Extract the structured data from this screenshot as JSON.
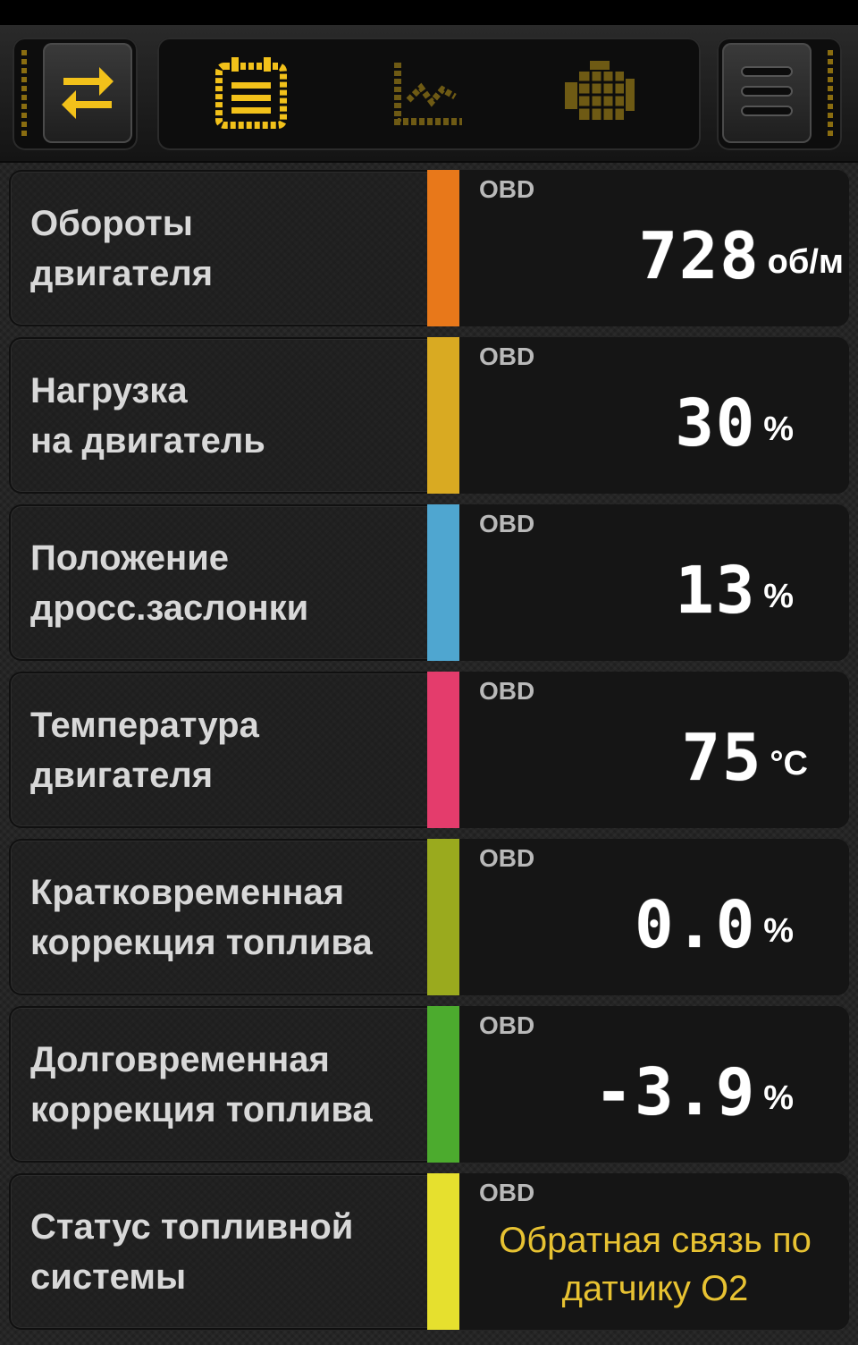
{
  "toolbar": {
    "left_button_icon": "swap-arrows-icon",
    "tabs": [
      {
        "icon": "dashboard-grid-icon",
        "active": true
      },
      {
        "icon": "chart-icon",
        "active": false
      },
      {
        "icon": "engine-icon",
        "active": false
      }
    ],
    "right_button_icon": "menu-icon"
  },
  "colors": {
    "accent": "#f2c11a",
    "inactive_icon": "#6e5a14"
  },
  "rows": [
    {
      "label": "Обороты\nдвигателя",
      "source": "OBD",
      "value": "728",
      "unit": "об/м",
      "bar_color": "#e8781a"
    },
    {
      "label": "Нагрузка\nна двигатель",
      "source": "OBD",
      "value": "30",
      "unit": "%",
      "bar_color": "#d9aa22"
    },
    {
      "label": "Положение\nдросс.заслонки",
      "source": "OBD",
      "value": "13",
      "unit": "%",
      "bar_color": "#4fa6d0"
    },
    {
      "label": "Температура\nдвигателя",
      "source": "OBD",
      "value": "75",
      "unit": "°C",
      "bar_color": "#e43c6c"
    },
    {
      "label": "Кратковременная\nкоррекция топлива",
      "source": "OBD",
      "value": "0.0",
      "unit": "%",
      "bar_color": "#9aaa1e"
    },
    {
      "label": "Долговременная\nкоррекция топлива",
      "source": "OBD",
      "value": "-3.9",
      "unit": "%",
      "bar_color": "#4cab2e"
    },
    {
      "label": "Статус топливной\nсистемы",
      "source": "OBD",
      "text_value": "Обратная связь по датчику O2",
      "bar_color": "#e6e02e"
    }
  ]
}
